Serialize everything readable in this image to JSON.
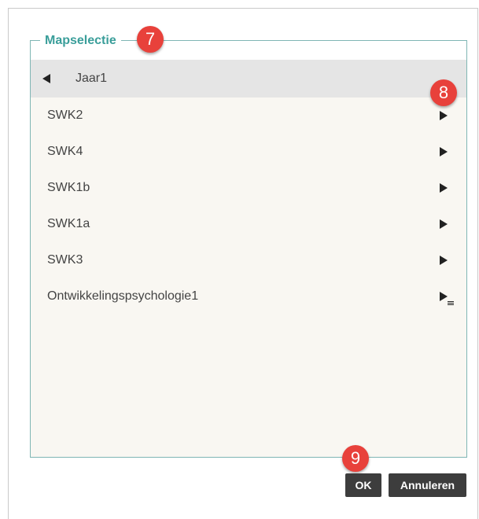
{
  "dialog": {
    "legend": "Mapselectie",
    "parent": {
      "label": "Jaar1",
      "icon": "back-arrow-icon"
    },
    "items": [
      {
        "label": "SWK2",
        "icon": "forward-arrow-icon"
      },
      {
        "label": "SWK4",
        "icon": "forward-arrow-icon"
      },
      {
        "label": "SWK1b",
        "icon": "forward-arrow-icon"
      },
      {
        "label": "SWK1a",
        "icon": "forward-arrow-icon"
      },
      {
        "label": "SWK3",
        "icon": "forward-arrow-icon"
      },
      {
        "label": "Ontwikkelingspsychologie1",
        "icon": "forward-arrow-list-icon"
      }
    ],
    "buttons": {
      "ok": "OK",
      "cancel": "Annuleren"
    }
  },
  "annotations": {
    "badge_7": "7",
    "badge_8": "8",
    "badge_9": "9"
  },
  "colors": {
    "accent": "#3a9e9a",
    "badge": "#e8413b",
    "button": "#3d3d3d",
    "parent_row": "#e5e5e5",
    "list_bg": "#f9f7f2"
  }
}
